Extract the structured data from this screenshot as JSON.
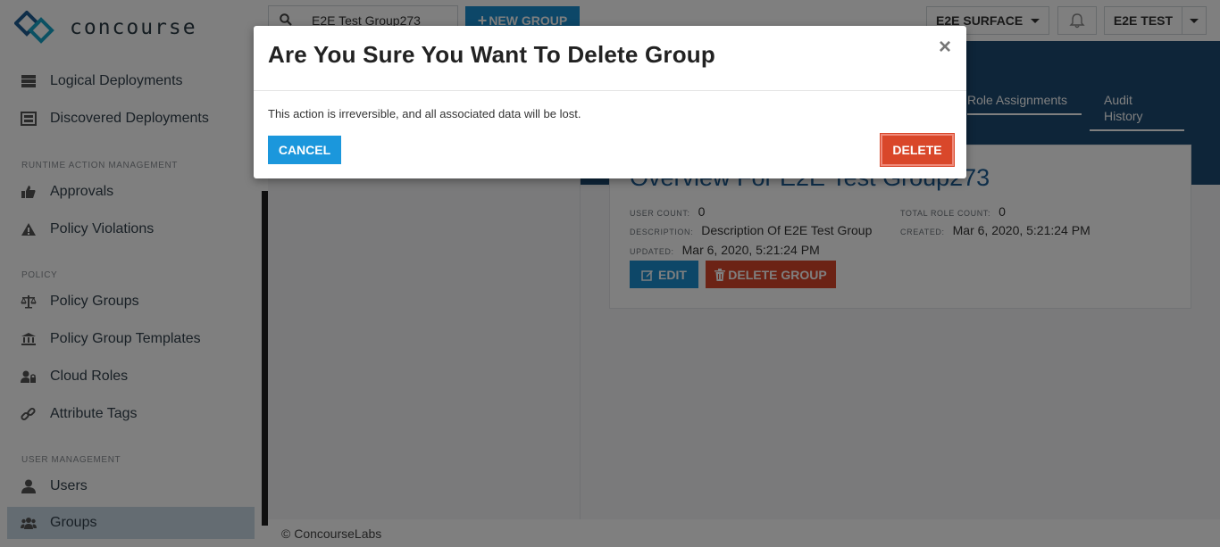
{
  "app": {
    "logo_text": "concourse"
  },
  "sidebar": {
    "items_top": [
      {
        "label": "Logical Deployments",
        "icon": "server-stack-icon"
      },
      {
        "label": "Discovered Deployments",
        "icon": "discovered-server-icon"
      }
    ],
    "section_runtime": "RUNTIME ACTION MANAGEMENT",
    "items_runtime": [
      {
        "label": "Approvals",
        "icon": "thumbs-up-icon"
      },
      {
        "label": "Policy Violations",
        "icon": "warning-icon"
      }
    ],
    "section_policy": "POLICY",
    "items_policy": [
      {
        "label": "Policy Groups",
        "icon": "balance-scale-icon"
      },
      {
        "label": "Policy Group Templates",
        "icon": "institution-icon"
      },
      {
        "label": "Cloud Roles",
        "icon": "user-lock-icon"
      },
      {
        "label": "Attribute Tags",
        "icon": "link-icon"
      }
    ],
    "section_user": "USER MANAGEMENT",
    "items_user": [
      {
        "label": "Users",
        "icon": "user-icon"
      },
      {
        "label": "Groups",
        "icon": "users-icon",
        "active": true
      }
    ]
  },
  "topbar": {
    "search_value": "E2E Test Group273",
    "new_group_label": "NEW GROUP",
    "surface_label": "E2E SURFACE",
    "user_label": "E2E TEST"
  },
  "tabs": [
    {
      "label": "Role Assignments"
    },
    {
      "label": "Audit History"
    }
  ],
  "overview": {
    "title": "Overview For E2E Test Group273",
    "user_count_label": "USER COUNT:",
    "user_count": "0",
    "total_role_count_label": "TOTAL ROLE COUNT:",
    "total_role_count": "0",
    "description_label": "DESCRIPTION:",
    "description": "Description Of E2E Test Group",
    "created_label": "CREATED:",
    "created": "Mar 6, 2020, 5:21:24 PM",
    "updated_label": "UPDATED:",
    "updated": "Mar 6, 2020, 5:21:24 PM",
    "edit_label": "EDIT",
    "delete_group_label": "DELETE GROUP"
  },
  "footer": {
    "text": "© ConcourseLabs"
  },
  "modal": {
    "title": "Are You Sure You Want To Delete Group",
    "close_symbol": "×",
    "body": "This action is irreversible, and all associated data will be lost.",
    "cancel_label": "CANCEL",
    "delete_label": "DELETE"
  },
  "colors": {
    "primary": "#1b8ed0",
    "danger": "#d9472a",
    "header_band": "#1c4a72",
    "active_nav": "#c8d8e4",
    "overlay": "rgba(0,0,0,0.5)"
  }
}
